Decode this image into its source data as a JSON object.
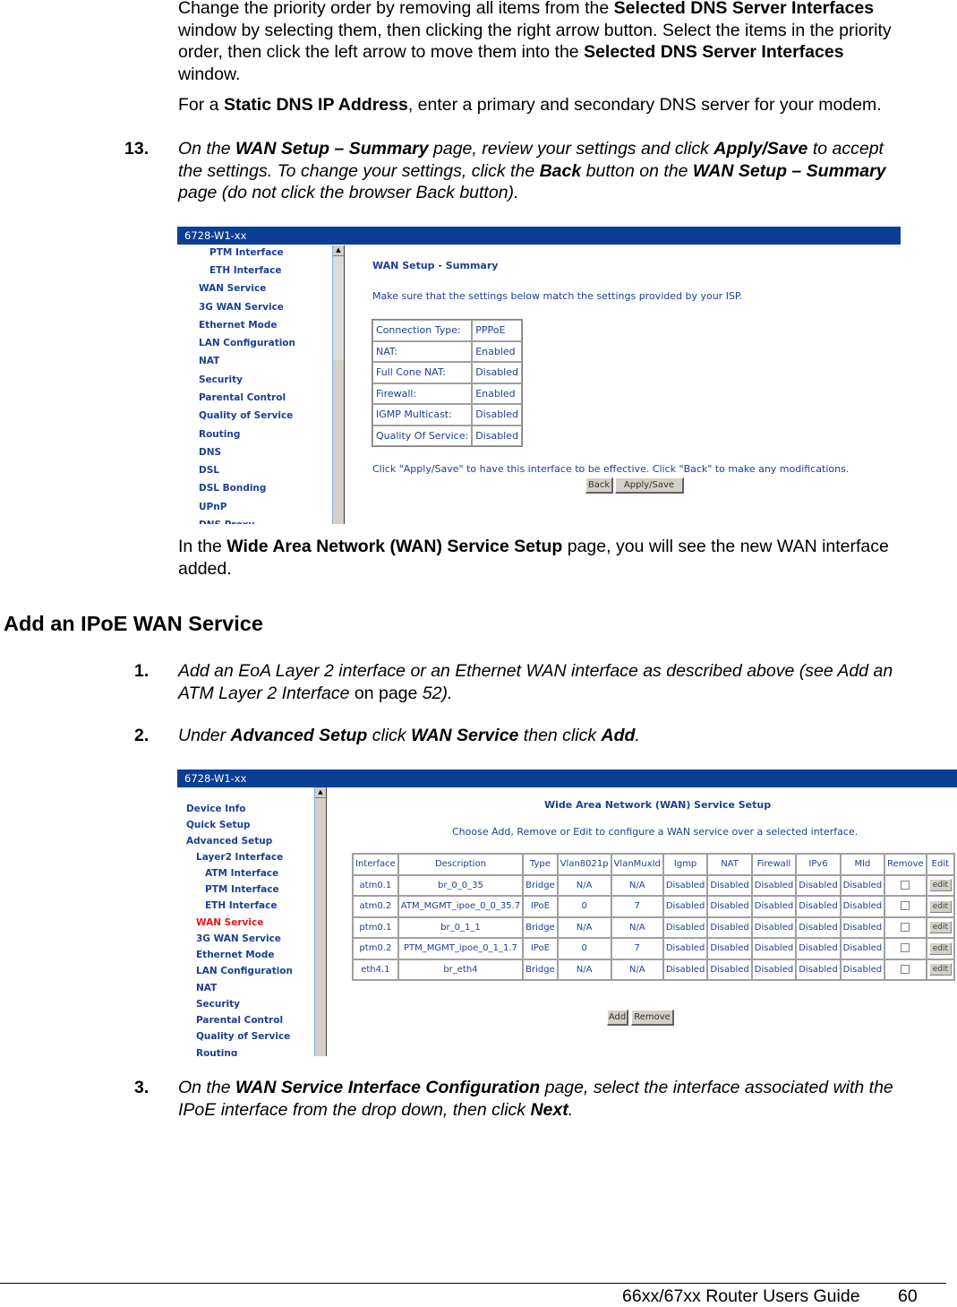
{
  "document": {
    "para_dns_priority": {
      "t1": "Change the priority order by removing all items from the ",
      "b1": "Selected DNS Server Interfaces",
      "t2": "window by selecting them, then clicking the right arrow button. Select the items in the priority",
      "t3": "order, then click the left arrow to move them into the ",
      "b2": "Selected DNS Server Interfaces",
      "t4": "window."
    },
    "para_static": {
      "t1": "For a ",
      "b1": "Static DNS IP Address",
      "t2": ", enter a primary and secondary DNS server for your modem."
    },
    "step13": {
      "number": "13.",
      "t1": "On the ",
      "b1": "WAN Setup – Summary",
      "t2": " page, review your settings and click ",
      "b2": "Apply/Save",
      "t3": " to accept",
      "t4": "the settings. To change your settings, click the ",
      "b3": "Back",
      "t5": " button on the ",
      "b4": "WAN Setup – Summary",
      "t6": "page (do not click the browser Back button)."
    },
    "para_wan_added": {
      "t1": "In the ",
      "b1": "Wide Area Network (WAN) Service Setup",
      "t2": " page, you will see the new WAN interface",
      "t3": "added."
    },
    "section_heading": "Add an IPoE WAN Service",
    "step1": {
      "number": "1.",
      "t1": "Add an EoA Layer 2 interface or an Ethernet WAN interface as described above (see Add an",
      "t2": "ATM Layer 2 Interface",
      "t3": " on page ",
      "t4": "52)."
    },
    "step2": {
      "number": "2.",
      "t1": "Under ",
      "b1": "Advanced Setup",
      "t2": " click ",
      "b2": "WAN Service",
      "t3": " then click ",
      "b3": "Add",
      "t4": "."
    },
    "step3": {
      "number": "3.",
      "t1": "On the ",
      "b1": "WAN Service Interface Configuration",
      "t2": " page, select the interface associated with the",
      "t3": "IPoE interface from the drop down, then click ",
      "b2": "Next",
      "t4": "."
    },
    "footer": {
      "title": "66xx/67xx Router Users Guide",
      "page": "60"
    }
  },
  "screenshot1": {
    "header": "6728-W1-xx",
    "nav": [
      "PTM Interface",
      "ETH Interface",
      "WAN Service",
      "3G WAN Service",
      "Ethernet Mode",
      "LAN Configuration",
      "NAT",
      "Security",
      "Parental Control",
      "Quality of Service",
      "Routing",
      "DNS",
      "DSL",
      "DSL Bonding",
      "UPnP",
      "DNS Proxy"
    ],
    "title": "WAN Setup - Summary",
    "intro": "Make sure that the settings below match the settings provided by your ISP.",
    "summary": [
      {
        "label": "Connection Type:",
        "value": "PPPoE"
      },
      {
        "label": "NAT:",
        "value": "Enabled"
      },
      {
        "label": "Full Cone NAT:",
        "value": "Disabled"
      },
      {
        "label": "Firewall:",
        "value": "Enabled"
      },
      {
        "label": "IGMP Multicast:",
        "value": "Disabled"
      },
      {
        "label": "Quality Of Service:",
        "value": "Disabled"
      }
    ],
    "note": "Click \"Apply/Save\" to have this interface to be effective. Click \"Back\" to make any modifications.",
    "back_label": "Back",
    "apply_label": "Apply/Save"
  },
  "screenshot2": {
    "header": "6728-W1-xx",
    "nav": [
      "Device Info",
      "Quick Setup",
      "Advanced Setup",
      "Layer2 Interface",
      "ATM Interface",
      "PTM Interface",
      "ETH Interface",
      "WAN Service",
      "3G WAN Service",
      "Ethernet Mode",
      "LAN Configuration",
      "NAT",
      "Security",
      "Parental Control",
      "Quality of Service",
      "Routing"
    ],
    "active_nav": "WAN Service",
    "title": "Wide Area Network (WAN) Service Setup",
    "intro": "Choose Add, Remove or Edit to configure a WAN service over a selected interface.",
    "columns": [
      "Interface",
      "Description",
      "Type",
      "Vlan8021p",
      "VlanMuxId",
      "Igmp",
      "NAT",
      "Firewall",
      "IPv6",
      "Mld",
      "Remove",
      "Edit"
    ],
    "rows": [
      [
        "atm0.1",
        "br_0_0_35",
        "Bridge",
        "N/A",
        "N/A",
        "Disabled",
        "Disabled",
        "Disabled",
        "Disabled",
        "Disabled"
      ],
      [
        "atm0.2",
        "ATM_MGMT_ipoe_0_0_35.7",
        "IPoE",
        "0",
        "7",
        "Disabled",
        "Disabled",
        "Disabled",
        "Disabled",
        "Disabled"
      ],
      [
        "ptm0.1",
        "br_0_1_1",
        "Bridge",
        "N/A",
        "N/A",
        "Disabled",
        "Disabled",
        "Disabled",
        "Disabled",
        "Disabled"
      ],
      [
        "ptm0.2",
        "PTM_MGMT_ipoe_0_1_1.7",
        "IPoE",
        "0",
        "7",
        "Disabled",
        "Disabled",
        "Disabled",
        "Disabled",
        "Disabled"
      ],
      [
        "eth4.1",
        "br_eth4",
        "Bridge",
        "N/A",
        "N/A",
        "Disabled",
        "Disabled",
        "Disabled",
        "Disabled",
        "Disabled"
      ]
    ],
    "edit_label": "edit",
    "add_label": "Add",
    "remove_label": "Remove"
  }
}
